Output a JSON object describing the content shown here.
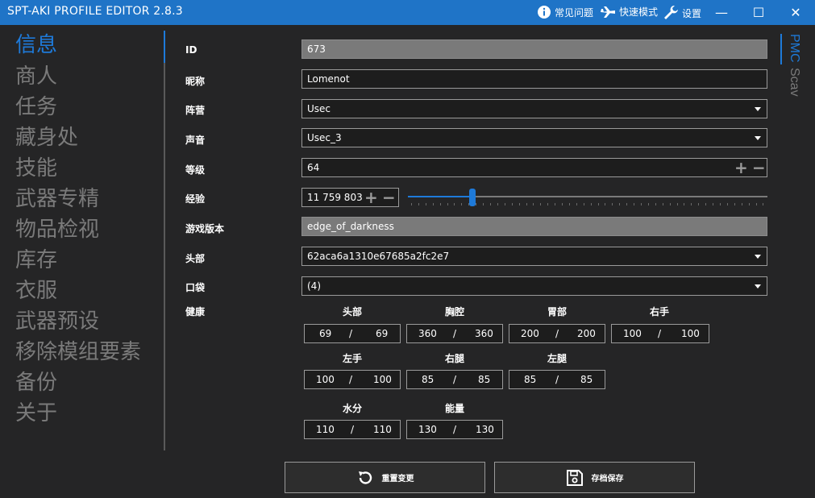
{
  "window": {
    "title": "SPT-AKI PROFILE EDITOR  2.8.3",
    "faq": "常见问题",
    "fast_mode": "快速模式",
    "settings": "设置",
    "minimize": "—",
    "maximize": "☐",
    "close": "✕"
  },
  "sidebar": {
    "items": [
      "信息",
      "商人",
      "任务",
      "藏身处",
      "技能",
      "武器专精",
      "物品检视",
      "库存",
      "衣服",
      "武器预设",
      "移除模组要素",
      "备份",
      "关于"
    ],
    "active_index": 0
  },
  "tabs": {
    "pmc": "PMC",
    "scav": "Scav"
  },
  "form": {
    "id_label": "ID",
    "id_value": "673",
    "nickname_label": "昵称",
    "nickname_value": "Lomenot",
    "side_label": "阵营",
    "side_value": "Usec",
    "voice_label": "声音",
    "voice_value": "Usec_3",
    "level_label": "等级",
    "level_value": "64",
    "experience_label": "经验",
    "experience_value": "11 759 803",
    "experience_slider_fraction": 0.18,
    "game_version_label": "游戏版本",
    "game_version_value": "edge_of_darkness",
    "head_label": "头部",
    "head_value": "62aca6a1310e67685a2fc2e7",
    "pockets_label": "口袋",
    "pockets_value": "(4)",
    "plus": "+",
    "minus": "−"
  },
  "health": {
    "label": "健康",
    "separator": "/",
    "parts": [
      {
        "name": "头部",
        "current": "69",
        "max": "69"
      },
      {
        "name": "胸腔",
        "current": "360",
        "max": "360"
      },
      {
        "name": "胃部",
        "current": "200",
        "max": "200"
      },
      {
        "name": "右手",
        "current": "100",
        "max": "100"
      },
      {
        "name": "左手",
        "current": "100",
        "max": "100"
      },
      {
        "name": "右腿",
        "current": "85",
        "max": "85"
      },
      {
        "name": "左腿",
        "current": "85",
        "max": "85"
      },
      {
        "name": "水分",
        "current": "110",
        "max": "110"
      },
      {
        "name": "能量",
        "current": "130",
        "max": "130"
      }
    ]
  },
  "buttons": {
    "reset": "重置变更",
    "save": "存档保存"
  },
  "colors": {
    "accent": "#1e7ad9",
    "titlebar": "#1f74c7",
    "background": "#252526"
  }
}
